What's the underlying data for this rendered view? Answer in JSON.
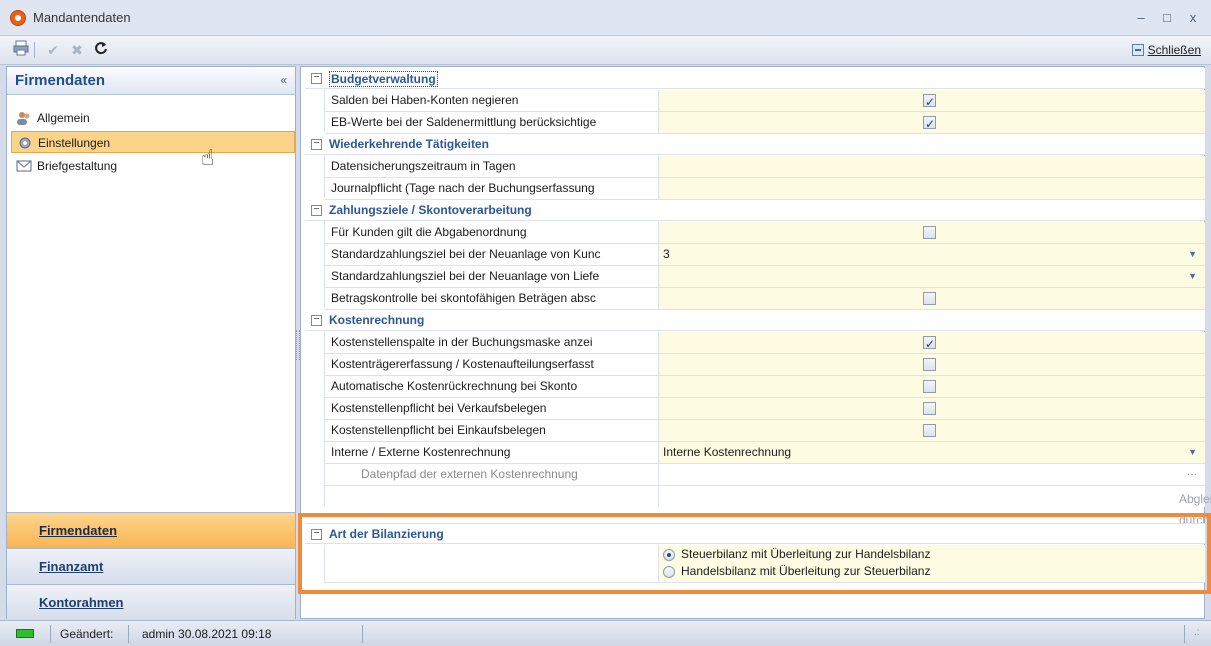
{
  "window": {
    "title": "Mandantendaten",
    "controls": [
      "–",
      "□",
      "x"
    ]
  },
  "toolbar": {
    "close_label": "Schließen"
  },
  "left": {
    "header": "Firmendaten",
    "collapse": "«",
    "items": [
      {
        "label": "Allgemein",
        "icon": "users-icon"
      },
      {
        "label": "Einstellungen",
        "icon": "gear-icon"
      },
      {
        "label": "Briefgestaltung",
        "icon": "letter-icon"
      }
    ],
    "bottom_buttons": [
      "Firmendaten",
      "Finanzamt",
      "Kontorahmen"
    ]
  },
  "grid": {
    "budget": {
      "title": "Budgetverwaltung",
      "rows": [
        {
          "label": "Salden bei Haben-Konten negieren",
          "checked": true
        },
        {
          "label": "EB-Werte bei der Saldenermittlung berücksichtige",
          "checked": true
        }
      ]
    },
    "wiederkehrend": {
      "title": "Wiederkehrende Tätigkeiten",
      "rows": [
        {
          "label": "Datensicherungszeitraum in Tagen",
          "value": ""
        },
        {
          "label": "Journalpflicht (Tage nach der Buchungserfassung",
          "value": ""
        }
      ]
    },
    "zahlung": {
      "title": "Zahlungsziele / Skontoverarbeitung",
      "rows": [
        {
          "label": "Für Kunden gilt die Abgabenordnung",
          "checked": false
        },
        {
          "label": "Standardzahlungsziel bei der Neuanlage von Kunc",
          "value": "3"
        },
        {
          "label": "Standardzahlungsziel bei der Neuanlage von Liefe",
          "value": ""
        },
        {
          "label": "Betragskontrolle bei skontofähigen Beträgen absc",
          "checked": false
        }
      ]
    },
    "kosten": {
      "title": "Kostenrechnung",
      "rows": [
        {
          "label": "Kostenstellenspalte in der Buchungsmaske anzei",
          "checked": true
        },
        {
          "label": "Kostenträgererfassung / Kostenaufteilungserfasst",
          "checked": false
        },
        {
          "label": "Automatische Kostenrückrechnung bei Skonto",
          "checked": false
        },
        {
          "label": "Kostenstellenpflicht bei Verkaufsbelegen",
          "checked": false
        },
        {
          "label": "Kostenstellenpflicht bei Einkaufsbelegen",
          "checked": false
        },
        {
          "label": "Interne / Externe Kostenrechnung",
          "value": "Interne Kostenrechnung"
        },
        {
          "label": "Datenpfad der externen Kostenrechnung",
          "value": ""
        }
      ],
      "action": "Abgleich durchführen"
    },
    "bilanz": {
      "title": "Art der Bilanzierung",
      "options": [
        {
          "label": "Steuerbilanz mit Überleitung zur Handelsbilanz",
          "selected": true
        },
        {
          "label": "Handelsbilanz mit Überleitung zur Steuerbilanz",
          "selected": false
        }
      ]
    }
  },
  "status": {
    "changed_label": "Geändert:",
    "changed_value": "admin 30.08.2021 09:18"
  },
  "colors": {
    "accent": "#f08a3c",
    "selection": "#fbd48a",
    "category_text": "#2b5797"
  }
}
